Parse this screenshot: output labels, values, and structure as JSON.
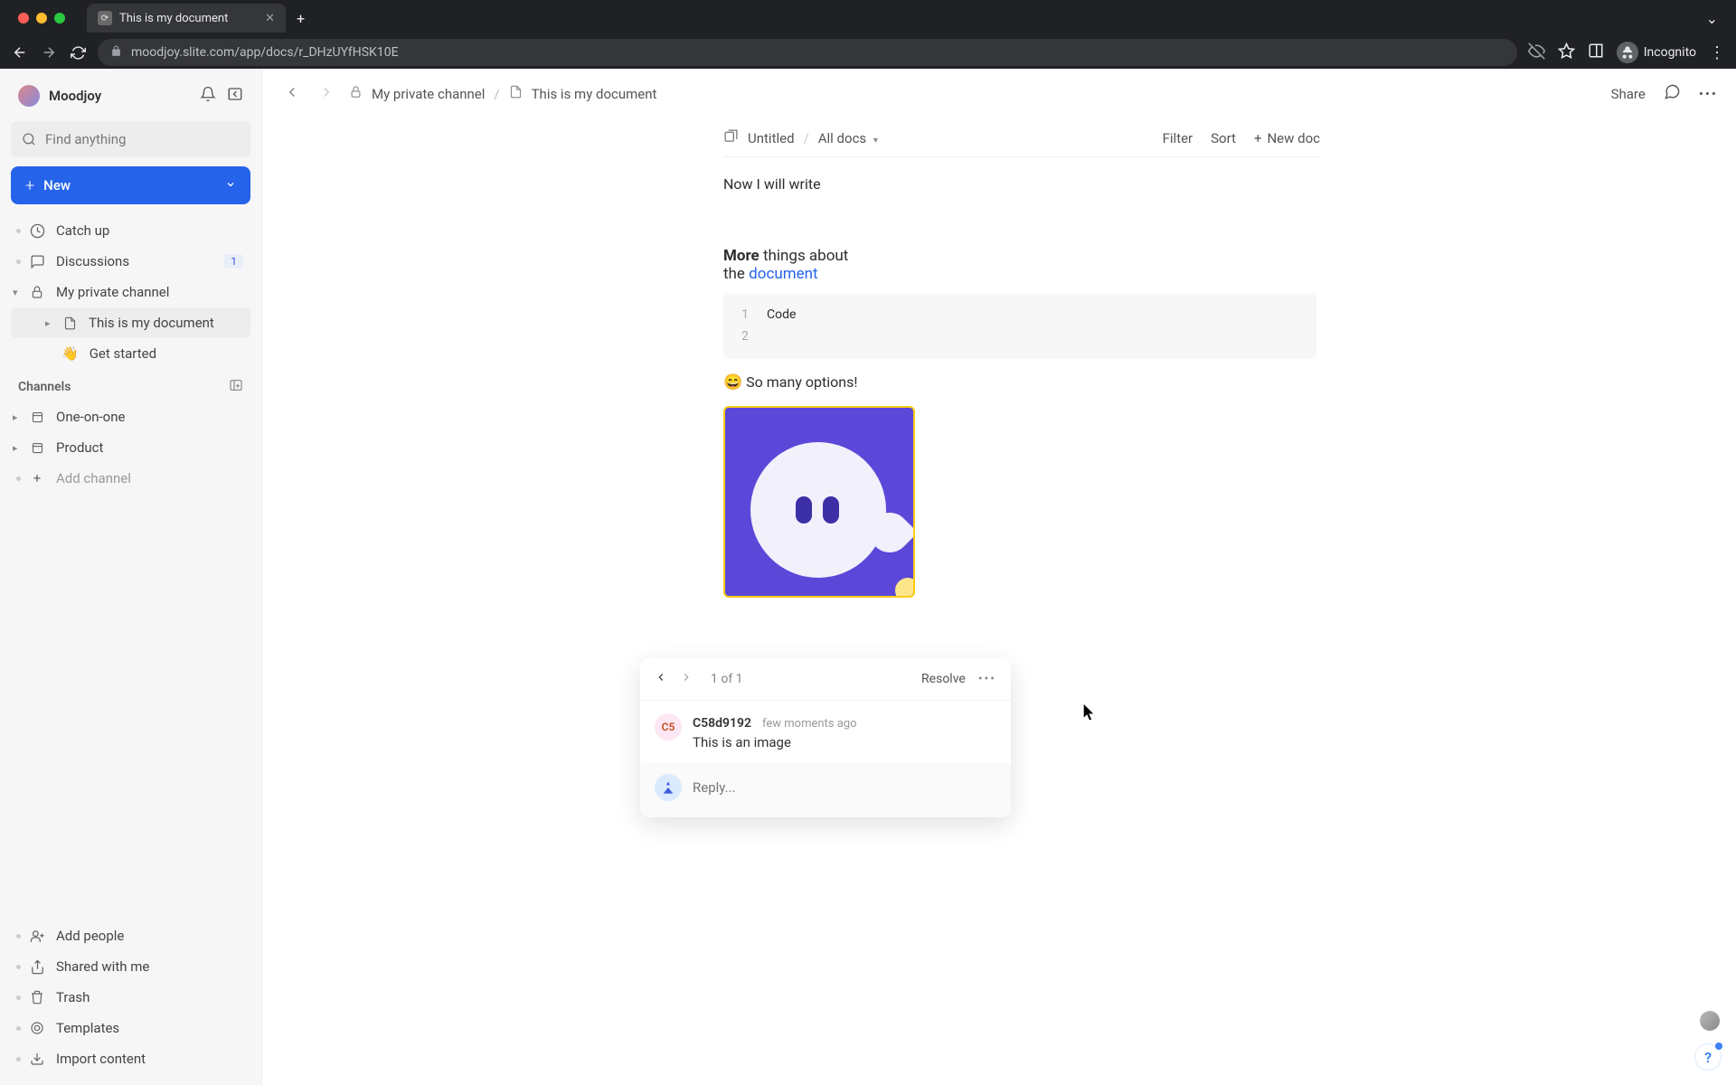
{
  "browser": {
    "tab_title": "This is my document",
    "url": "moodjoy.slite.com/app/docs/r_DHzUYfHSK10E",
    "incognito_label": "Incognito"
  },
  "workspace": {
    "name": "Moodjoy"
  },
  "search": {
    "placeholder": "Find anything"
  },
  "new_button": {
    "label": "New"
  },
  "nav": {
    "catch_up": "Catch up",
    "discussions": "Discussions",
    "discussions_badge": "1",
    "private_channel": "My private channel",
    "doc_current": "This is my document",
    "get_started": "Get started"
  },
  "channels": {
    "heading": "Channels",
    "one_on_one": "One-on-one",
    "product": "Product",
    "add_channel": "Add channel"
  },
  "sidebar_bottom": {
    "add_people": "Add people",
    "shared": "Shared with me",
    "trash": "Trash",
    "templates": "Templates",
    "import": "Import content"
  },
  "breadcrumb": {
    "parent": "My private channel",
    "current": "This is my document"
  },
  "topbar": {
    "share": "Share"
  },
  "sub_toolbar": {
    "untitled": "Untitled",
    "all_docs": "All docs",
    "filter": "Filter",
    "sort": "Sort",
    "new_doc": "New doc"
  },
  "document": {
    "line1": "Now I will write",
    "rich_bold": "More",
    "rich_mid": " things about the ",
    "rich_link": "document",
    "code_label": "Code",
    "emoji_line_emoji": "😄",
    "emoji_line_text": "So many options!"
  },
  "comment": {
    "counter": "1 of 1",
    "resolve": "Resolve",
    "author_initials": "C5",
    "author_name": "C58d9192",
    "timestamp": "few moments ago",
    "text": "This is an image",
    "reply_placeholder": "Reply..."
  }
}
